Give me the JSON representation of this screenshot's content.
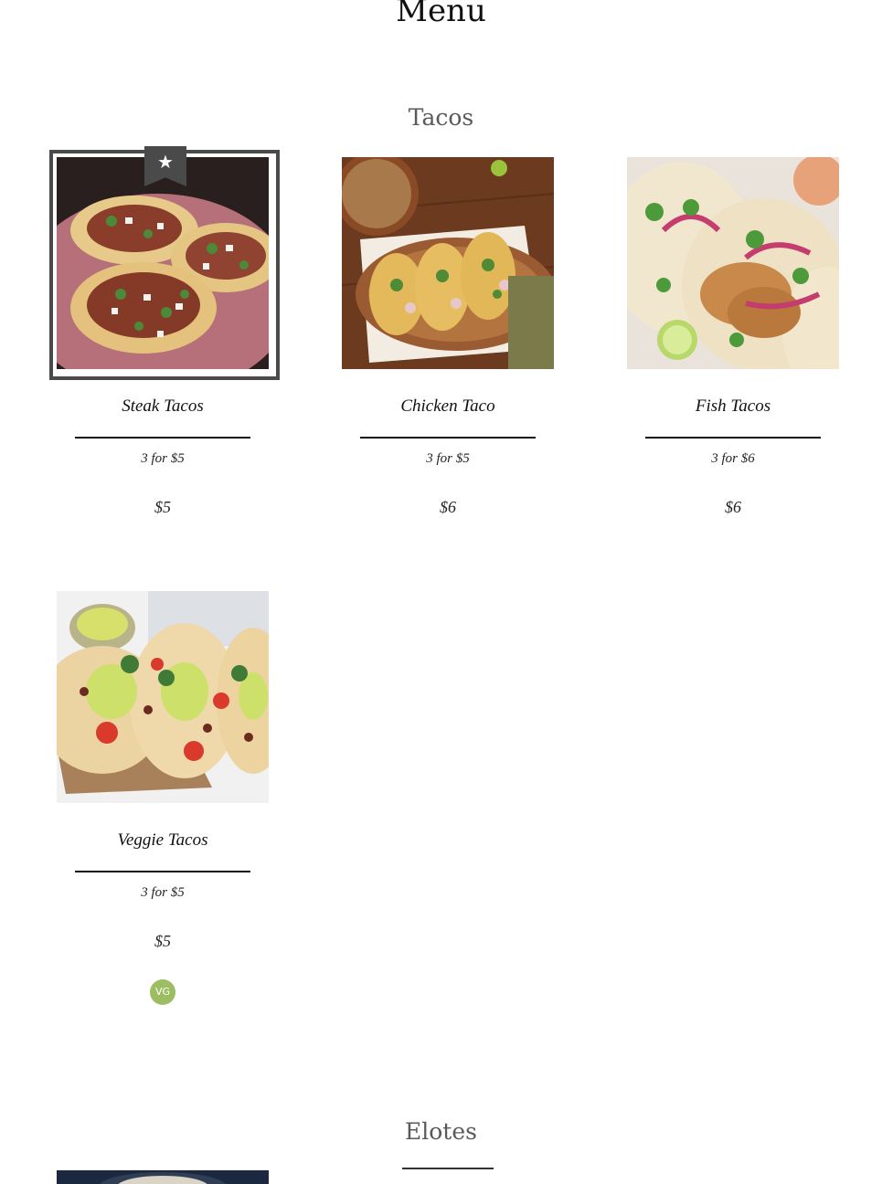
{
  "menu": {
    "title": "Menu"
  },
  "sections": [
    {
      "title": "Tacos"
    },
    {
      "title": "Elotes"
    }
  ],
  "items": [
    {
      "name": "Steak Tacos",
      "description": "3 for $5",
      "price": "$5",
      "featured_icon": "star-icon",
      "featured_glyph": "★"
    },
    {
      "name": "Chicken Taco",
      "description": "3 for $5",
      "price": "$6"
    },
    {
      "name": "Fish Tacos",
      "description": "3 for $6",
      "price": "$6"
    },
    {
      "name": "Veggie Tacos",
      "description": "3 for $5",
      "price": "$5",
      "dietary_badge": "VG",
      "dietary_color": "#9dbd63"
    }
  ],
  "colors": {
    "section_title": "#5a5a5a",
    "featured_frame": "#4a4a4a"
  }
}
